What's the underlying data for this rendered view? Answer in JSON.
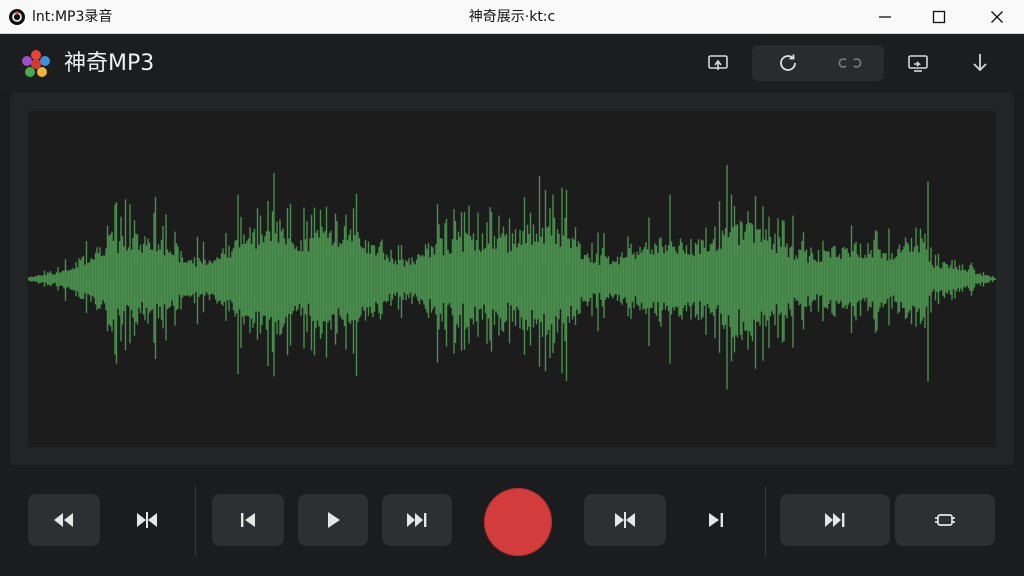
{
  "window": {
    "app_name": "lnt:MP3录音",
    "title": "神奇展示·kt:c",
    "controls": [
      "minimize-icon",
      "maximize-icon",
      "close-icon"
    ]
  },
  "header": {
    "brand": "神奇MP3",
    "buttons": [
      "cast-icon",
      "refresh-icon",
      "loop-icon",
      "screen-share-icon",
      "download-icon"
    ]
  },
  "waveform": {
    "color": "#4a8f4d",
    "background": "#1c1c1d"
  },
  "transport": {
    "buttons": [
      "rewind-icon",
      "trim-icon",
      "skip-start-icon",
      "play-icon",
      "fast-forward-icon",
      "record-button",
      "trim-icon",
      "skip-end-icon",
      "next-icon",
      "repeat-icon"
    ],
    "record_color": "#d23c3c"
  }
}
